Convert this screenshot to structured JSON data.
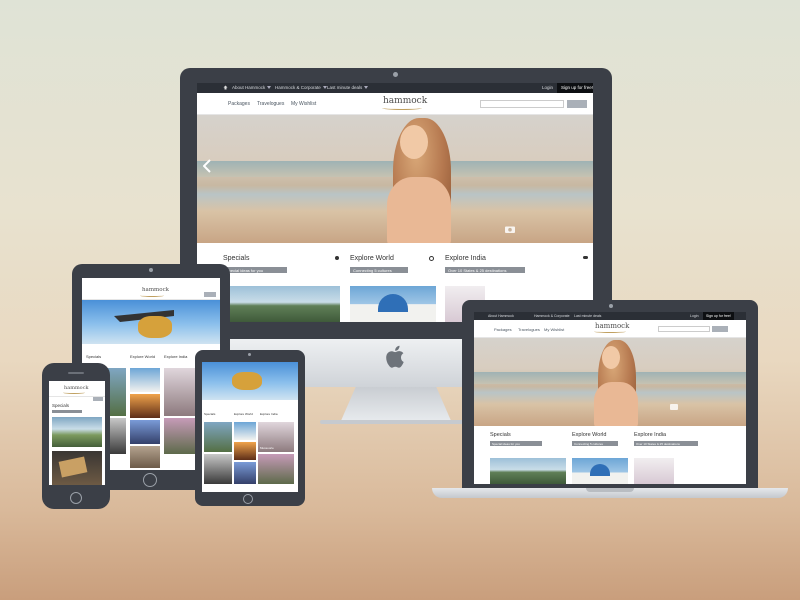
{
  "site": {
    "top_nav": [
      {
        "label": "About Hammock"
      },
      {
        "label": "Hammock & Corporate"
      },
      {
        "label": "Last minute deals"
      }
    ],
    "login_label": "Login",
    "signup_label": "Sign up for free!",
    "nav_links": [
      "Packages",
      "Travelogues",
      "My Wishlist"
    ],
    "logo_text": "hammock",
    "sections": [
      {
        "title": "Specials",
        "tag": "Special ideas for you"
      },
      {
        "title": "Explore World",
        "tag": "Connecting 5 cultures"
      },
      {
        "title": "Explore India",
        "tag": "Over 10 States & 25 destinations"
      }
    ],
    "tablet_sections": [
      "Specials",
      "Explore World",
      "Explore India"
    ],
    "tablet_caption": "Mussoorie",
    "phone_section": "Specials"
  },
  "colors": {
    "topbar": "#2b2f36",
    "device_frame": "#3b3f47",
    "tag": "#8a8f96",
    "accent_logo": "#c0a060"
  },
  "icons": [
    "home-icon",
    "apple-logo-icon",
    "camera-icon",
    "chevron-left-icon",
    "search-icon"
  ]
}
